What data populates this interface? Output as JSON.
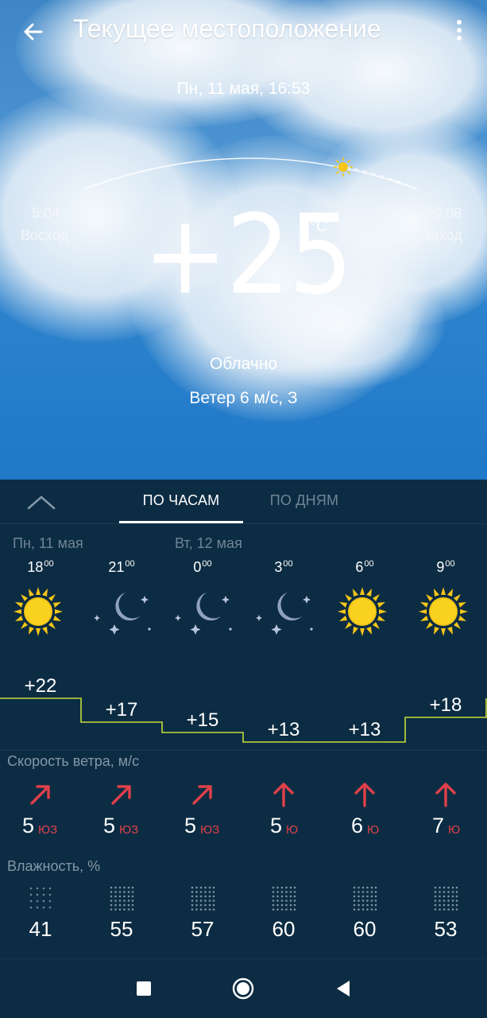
{
  "header": {
    "title": "Текущее местоположение",
    "datetime": "Пн, 11 мая, 16:53"
  },
  "sun": {
    "sunrise_time": "5:04",
    "sunrise_label": "Восход",
    "sunset_time": "20:08",
    "sunset_label": "Заход"
  },
  "current": {
    "temperature": "+25",
    "unit": "°C",
    "condition": "Облачно",
    "wind": "Ветер 6 м/с, З"
  },
  "tabs": [
    {
      "label": "ПО ЧАСАМ",
      "active": true
    },
    {
      "label": "ПО ДНЯМ",
      "active": false
    }
  ],
  "day_labels": [
    "Пн, 11 мая",
    "Вт, 12 мая"
  ],
  "hourly": [
    {
      "hour": "18",
      "minutes": "00",
      "icon": "sun-icon",
      "temp": "+22",
      "wind_speed": "5",
      "wind_dir": "ЮЗ",
      "humidity": "41"
    },
    {
      "hour": "21",
      "minutes": "00",
      "icon": "moon-stars-icon",
      "temp": "+17",
      "wind_speed": "5",
      "wind_dir": "ЮЗ",
      "humidity": "55"
    },
    {
      "hour": "0",
      "minutes": "00",
      "icon": "moon-stars-icon",
      "temp": "+15",
      "wind_speed": "5",
      "wind_dir": "ЮЗ",
      "humidity": "57"
    },
    {
      "hour": "3",
      "minutes": "00",
      "icon": "moon-stars-icon",
      "temp": "+13",
      "wind_speed": "5",
      "wind_dir": "Ю",
      "humidity": "60"
    },
    {
      "hour": "6",
      "minutes": "00",
      "icon": "sun-icon",
      "temp": "+13",
      "wind_speed": "6",
      "wind_dir": "Ю",
      "humidity": "60"
    },
    {
      "hour": "9",
      "minutes": "00",
      "icon": "sun-icon",
      "temp": "+18",
      "wind_speed": "7",
      "wind_dir": "Ю",
      "humidity": "53"
    }
  ],
  "sections": {
    "wind_title": "Скорость ветра, м/с",
    "humidity_title": "Влажность, %"
  },
  "colors": {
    "panel_bg": "#0c2c43",
    "graph_line": "#c6dc3a",
    "wind_arrow": "#e0404a",
    "sun": "#f5c518",
    "moon": "#8fa0c0"
  }
}
